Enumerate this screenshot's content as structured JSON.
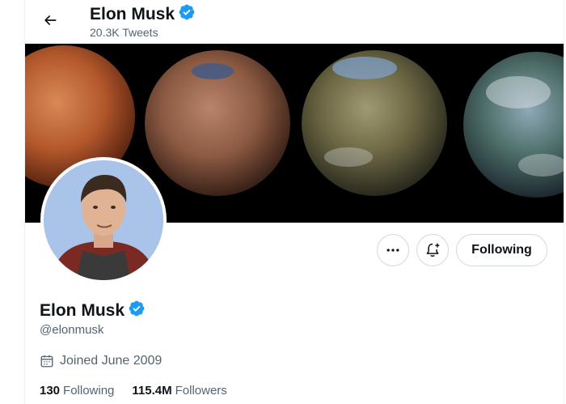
{
  "header": {
    "name": "Elon Musk",
    "tweet_count": "20.3K Tweets"
  },
  "profile": {
    "name": "Elon Musk",
    "handle": "@elonmusk",
    "joined": "Joined June 2009",
    "following_count": "130",
    "following_label": "Following",
    "followers_count": "115.4M",
    "followers_label": "Followers"
  },
  "actions": {
    "following_button": "Following"
  },
  "icons": {
    "back": "arrow-left-icon",
    "verified": "verified-badge-icon",
    "more": "more-dots-icon",
    "notify": "bell-plus-icon",
    "calendar": "calendar-icon"
  },
  "colors": {
    "verified_blue": "#1d9bf0",
    "text_primary": "#0f1419",
    "text_secondary": "#536471",
    "border": "#cfd9de"
  }
}
